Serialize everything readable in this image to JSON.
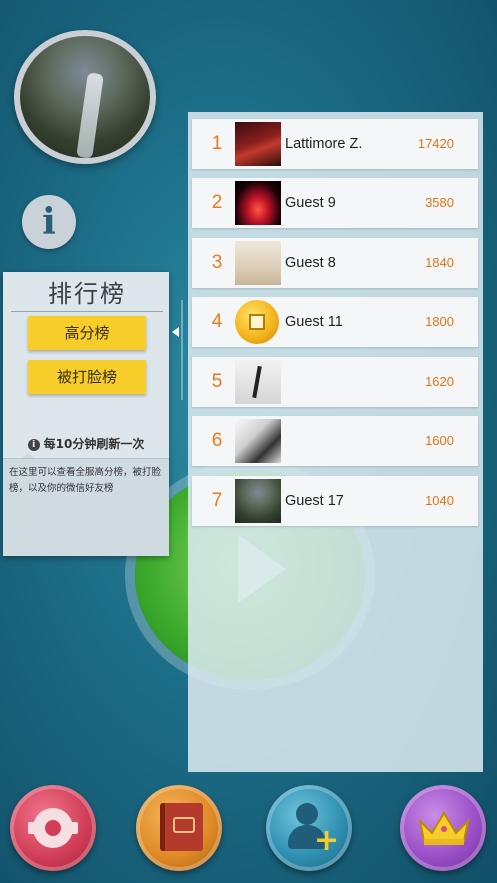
{
  "popup": {
    "title": "排行榜",
    "high_score_button": "高分榜",
    "face_slapped_button": "被打脸榜",
    "refresh_note": "每10分钟刷新一次",
    "description": "在这里可以查看全服高分榜，被打脸榜，以及你的微信好友榜"
  },
  "leaderboard": {
    "rows": [
      {
        "rank": "1",
        "name": "Lattimore Z.",
        "score": "17420",
        "avatar": "swords-avatar"
      },
      {
        "rank": "2",
        "name": "Guest 9",
        "score": "3580",
        "avatar": "candle-avatar"
      },
      {
        "rank": "3",
        "name": "Guest 8",
        "score": "1840",
        "avatar": "portrait-avatar"
      },
      {
        "rank": "4",
        "name": "Guest 11",
        "score": "1800",
        "avatar": "coin-avatar"
      },
      {
        "rank": "5",
        "name": "",
        "score": "1620",
        "avatar": "silhouette-avatar"
      },
      {
        "rank": "6",
        "name": "",
        "score": "1600",
        "avatar": "photo-avatar"
      },
      {
        "rank": "7",
        "name": "Guest 17",
        "score": "1040",
        "avatar": "waterfall-avatar"
      }
    ]
  },
  "background": {
    "info_icon": "i"
  },
  "toolbar": {
    "icons": [
      "gear-icon",
      "book-icon",
      "add-friend-icon",
      "crown-icon"
    ]
  },
  "colors": {
    "accent_yellow": "#f7cd2a",
    "score_orange": "#e07418",
    "teal_bg": "#1c6c86"
  }
}
